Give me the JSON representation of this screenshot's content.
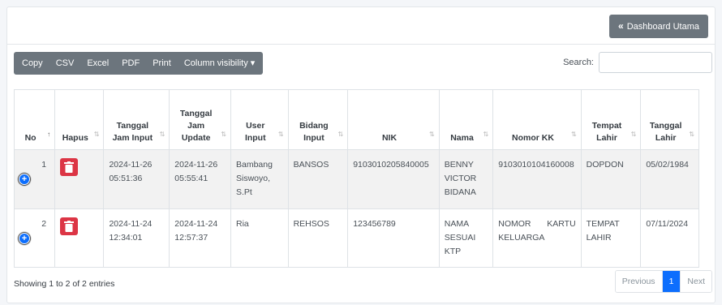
{
  "header": {
    "dashboard_button": "Dashboard Utama",
    "dashboard_icon": "«"
  },
  "toolbar": [
    "Copy",
    "CSV",
    "Excel",
    "PDF",
    "Print",
    "Column visibility ▾"
  ],
  "search": {
    "label": "Search:",
    "value": ""
  },
  "columns": [
    "No",
    "Hapus",
    "Tanggal Jam Input",
    "Tanggal Jam Update",
    "User Input",
    "Bidang Input",
    "NIK",
    "Nama",
    "Nomor KK",
    "Tempat Lahir",
    "Tanggal Lahir"
  ],
  "rows": [
    {
      "no": "1",
      "tgl_input": "2024-11-26 05:51:36",
      "tgl_update": "2024-11-26 05:55:41",
      "user": "Bambang Siswoyo, S.Pt",
      "bidang": "BANSOS",
      "nik": "9103010205840005",
      "nama": "BENNY VICTOR BIDANA",
      "kk": "9103010104160008",
      "tempat": "DOPDON",
      "tanggal": "05/02/1984"
    },
    {
      "no": "2",
      "tgl_input": "2024-11-24 12:34:01",
      "tgl_update": "2024-11-24 12:57:37",
      "user": "Ria",
      "bidang": "REHSOS",
      "nik": "123456789",
      "nama": "NAMA SESUAI KTP",
      "kk": "NOMOR KARTU KELUARGA",
      "tempat": "TEMPAT LAHIR",
      "tanggal": "07/11/2024"
    }
  ],
  "info": "Showing 1 to 2 of 2 entries",
  "pagination": {
    "previous": "Previous",
    "current": "1",
    "next": "Next"
  },
  "colors": {
    "primary": "#0d6efd",
    "danger": "#dc3545",
    "secondary": "#6c757d"
  }
}
